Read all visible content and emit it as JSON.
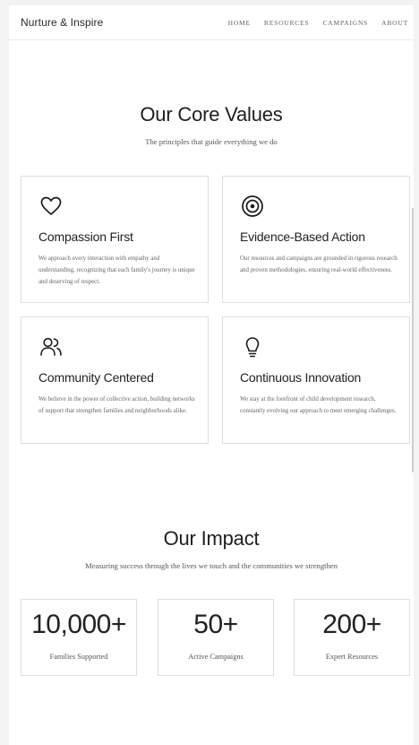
{
  "header": {
    "brand": "Nurture & Inspire",
    "nav": [
      "HOME",
      "RESOURCES",
      "CAMPAIGNS",
      "ABOUT"
    ]
  },
  "values": {
    "title": "Our Core Values",
    "subtitle": "The principles that guide everything we do",
    "cards": [
      {
        "icon": "heart-icon",
        "title": "Compassion First",
        "description": "We approach every interaction with empathy and understanding, recognizing that each family's journey is unique and deserving of respect."
      },
      {
        "icon": "target-icon",
        "title": "Evidence-Based Action",
        "description": "Our resources and campaigns are grounded in rigorous research and proven methodologies, ensuring real-world effectiveness."
      },
      {
        "icon": "users-icon",
        "title": "Community Centered",
        "description": "We believe in the power of collective action, building networks of support that strengthen families and neighborhoods alike."
      },
      {
        "icon": "lightbulb-icon",
        "title": "Continuous Innovation",
        "description": "We stay at the forefront of child development research, constantly evolving our approach to meet emerging challenges."
      }
    ]
  },
  "impact": {
    "title": "Our Impact",
    "subtitle": "Measuring success through the lives we touch and the communities we strengthen",
    "stats": [
      {
        "value": "10,000+",
        "label": "Families Supported"
      },
      {
        "value": "50+",
        "label": "Active Campaigns"
      },
      {
        "value": "200+",
        "label": "Expert Resources"
      }
    ]
  }
}
